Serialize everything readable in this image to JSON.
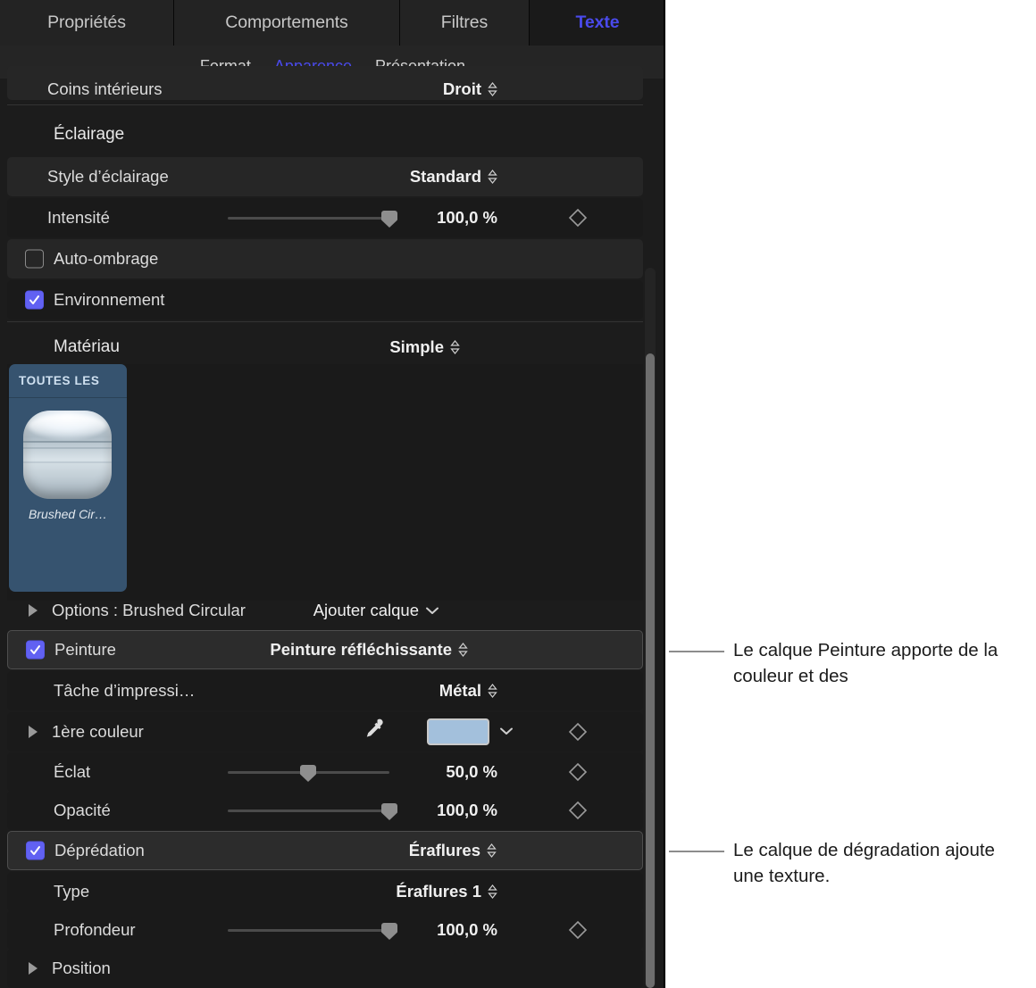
{
  "tabs": {
    "items": [
      {
        "label": "Propriétés",
        "active": false
      },
      {
        "label": "Comportements",
        "active": false
      },
      {
        "label": "Filtres",
        "active": false
      },
      {
        "label": "Texte",
        "active": true
      }
    ],
    "active_color": "#4a4aec"
  },
  "subtabs": {
    "items": [
      {
        "label": "Format",
        "active": false
      },
      {
        "label": "Apparence",
        "active": true
      },
      {
        "label": "Présentation",
        "active": false
      }
    ]
  },
  "rows": {
    "coins_interieurs": {
      "label": "Coins intérieurs",
      "value": "Droit"
    },
    "eclairage_header": {
      "label": "Éclairage"
    },
    "style_eclairage": {
      "label": "Style d’éclairage",
      "value": "Standard"
    },
    "intensite": {
      "label": "Intensité",
      "value": "100,0 %",
      "slider_pct": 100
    },
    "auto_ombrage": {
      "label": "Auto-ombrage",
      "checked": false
    },
    "environnement": {
      "label": "Environnement",
      "checked": true
    },
    "materiau": {
      "label": "Matériau",
      "value": "Simple"
    },
    "options": {
      "label": "Options : Brushed Circular",
      "action": "Ajouter calque"
    },
    "peinture": {
      "label": "Peinture",
      "value": "Peinture réfléchissante",
      "checked": true
    },
    "tache": {
      "label": "Tâche d’impressi…",
      "value": "Métal"
    },
    "premiere_couleur": {
      "label": "1ère couleur",
      "swatch": "#a3c0dc"
    },
    "eclat": {
      "label": "Éclat",
      "value": "50,0 %",
      "slider_pct": 50
    },
    "opacite": {
      "label": "Opacité",
      "value": "100,0 %",
      "slider_pct": 100
    },
    "depredation": {
      "label": "Déprédation",
      "value": "Éraflures",
      "checked": true
    },
    "type": {
      "label": "Type",
      "value": "Éraflures 1"
    },
    "profondeur": {
      "label": "Profondeur",
      "value": "100,0 %",
      "slider_pct": 100
    },
    "position": {
      "label": "Position"
    }
  },
  "material_browser": {
    "category_label": "TOUTES LES",
    "item_name": "Brushed Cir…"
  },
  "callouts": [
    {
      "text": "Le calque Peinture apporte de la couleur et des"
    },
    {
      "text": "Le calque de dégradation ajoute une texture."
    }
  ],
  "colors": {
    "accent": "#4a4aec",
    "checkbox_on": "#6161f2",
    "swatch": "#a3c0dc",
    "panel_bg": "#1c1c1c",
    "selection_blue": "#36536f"
  }
}
